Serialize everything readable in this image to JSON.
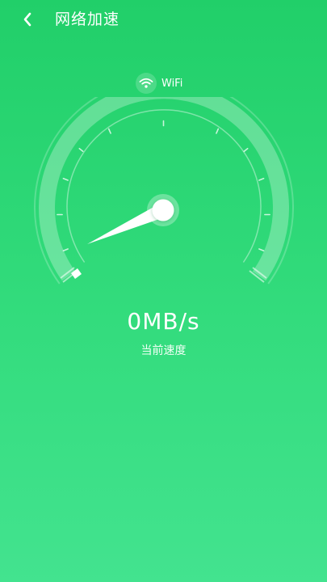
{
  "header": {
    "title": "网络加速",
    "back_icon": "chevron-left-icon"
  },
  "network": {
    "icon": "wifi-icon",
    "label": "WiFi"
  },
  "speed": {
    "value": "0MB/s",
    "caption": "当前速度"
  },
  "gauge": {
    "level": 0
  },
  "colors": {
    "background_top": "#21cf69",
    "background_bottom": "#43e38f",
    "text": "#ffffff"
  }
}
